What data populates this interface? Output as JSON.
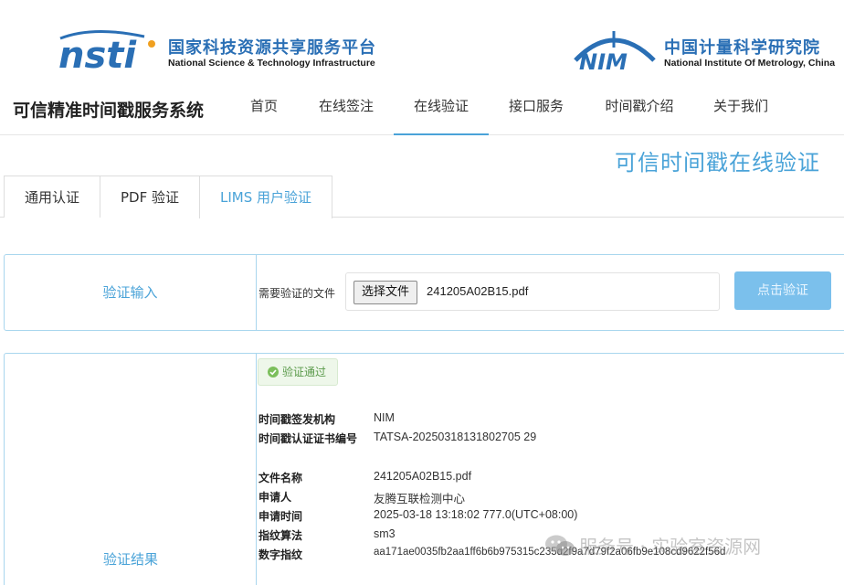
{
  "banner": {
    "nsti_logo_text": "nsti",
    "nsti_cn": "国家科技资源共享服务平台",
    "nsti_en": "National Science & Technology Infrastructure",
    "nim_logo_text": "NIM",
    "nim_cn": "中国计量科学研究院",
    "nim_en": "National Institute Of Metrology, China"
  },
  "nav": {
    "system_title": "可信精准时间戳服务系统",
    "items": [
      {
        "label": "首页"
      },
      {
        "label": "在线签注"
      },
      {
        "label": "在线验证"
      },
      {
        "label": "接口服务"
      },
      {
        "label": "时间戳介绍"
      },
      {
        "label": "关于我们"
      }
    ],
    "active_index": 2
  },
  "page_heading": "可信时间戳在线验证",
  "tabs": [
    {
      "label": "通用认证"
    },
    {
      "label": "PDF 验证"
    },
    {
      "label": "LIMS 用户验证"
    }
  ],
  "input_panel": {
    "label": "验证输入",
    "file_label": "需要验证的文件",
    "choose_button": "选择文件",
    "file_name": "241205A02B15.pdf",
    "verify_button": "点击验证"
  },
  "result_panel": {
    "label": "验证结果",
    "status_badge": "验证通过",
    "fields": [
      {
        "key": "时间戳签发机构",
        "value": "NIM"
      },
      {
        "key": "时间戳认证证书编号",
        "value": "TATSA-20250318131802705 29"
      },
      {
        "key": "文件名称",
        "value": "241205A02B15.pdf"
      },
      {
        "key": "申请人",
        "value": "友腾互联检测中心"
      },
      {
        "key": "申请时间",
        "value": "2025-03-18 13:18:02 777.0(UTC+08:00)"
      },
      {
        "key": "指纹算法",
        "value": "sm3"
      },
      {
        "key": "数字指纹",
        "value": "aa171ae0035fb2aa1ff6b6b975315c235d2f9a7d79f2a06fb9e108cd9622f56d"
      }
    ]
  },
  "watermark": {
    "text": "服务号 · 实验室资源网",
    "icon": "wechat-icon"
  },
  "colors": {
    "accent": "#4aa3d8",
    "panel_border": "#a9d6ee",
    "brand_blue": "#2a6fb5",
    "success_green": "#5a9a4a"
  }
}
